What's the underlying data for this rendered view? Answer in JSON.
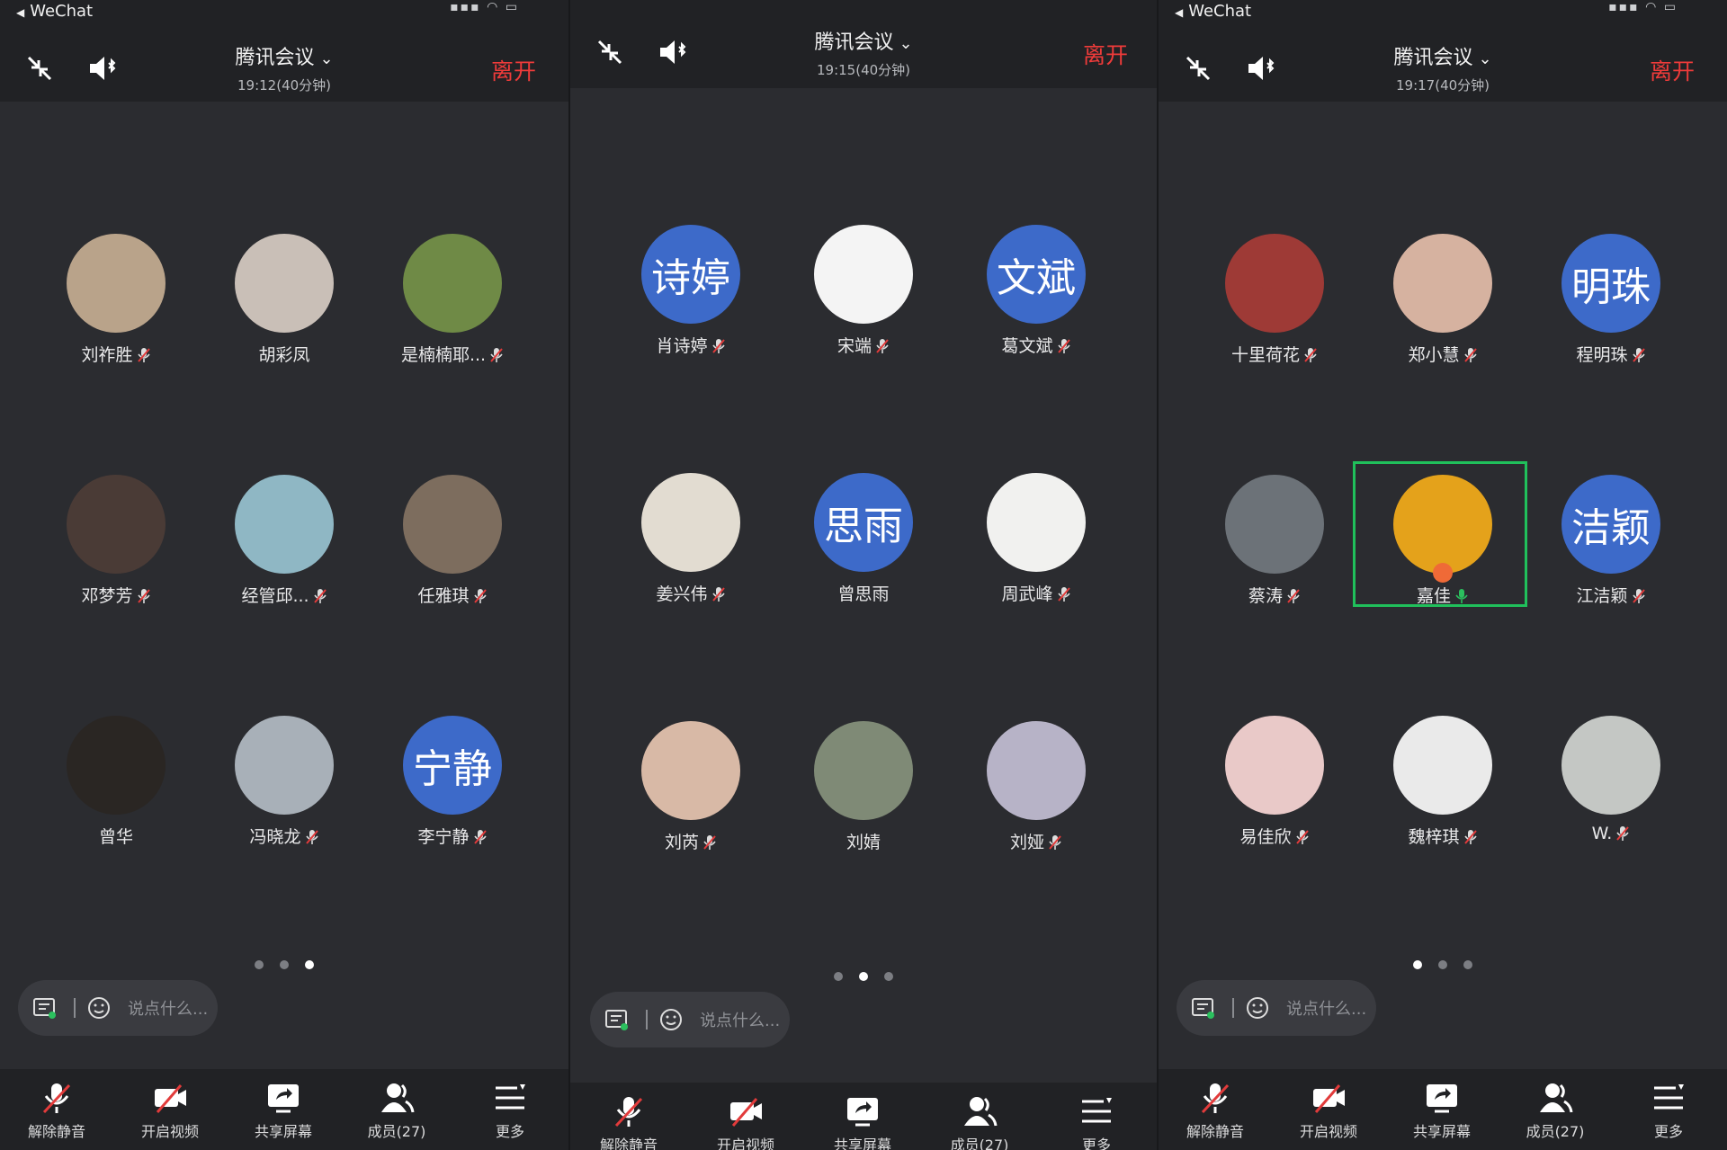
{
  "common": {
    "status_app": "WeChat",
    "meeting_title": "腾讯会议",
    "leave_label": "离开",
    "chat_placeholder": "说点什么...",
    "toolbar": [
      "解除静音",
      "开启视频",
      "共享屏幕",
      "成员(27)",
      "更多"
    ]
  },
  "panels": [
    {
      "time": "19:12(40分钟)",
      "active_page": 3,
      "participants": [
        {
          "name": "刘祚胜",
          "avatar_text": "",
          "photo_color": "#b9a38a",
          "muted": true
        },
        {
          "name": "胡彩凤",
          "avatar_text": "",
          "photo_color": "#c9bfb7",
          "muted": false
        },
        {
          "name": "是楠楠耶...",
          "avatar_text": "",
          "photo_color": "#6f8a46",
          "muted": true
        },
        {
          "name": "邓梦芳",
          "avatar_text": "",
          "photo_color": "#4a3b36",
          "muted": true
        },
        {
          "name": "经管邱...",
          "avatar_text": "",
          "photo_color": "#8fb7c4",
          "muted": true
        },
        {
          "name": "任雅琪",
          "avatar_text": "",
          "photo_color": "#7d6d5e",
          "muted": true
        },
        {
          "name": "曾华",
          "avatar_text": "",
          "photo_color": "#2a2623",
          "muted": false
        },
        {
          "name": "冯晓龙",
          "avatar_text": "",
          "photo_color": "#a8b0b8",
          "muted": true
        },
        {
          "name": "李宁静",
          "avatar_text": "宁静",
          "photo_color": "",
          "muted": true
        }
      ]
    },
    {
      "time": "19:15(40分钟)",
      "active_page": 2,
      "participants": [
        {
          "name": "肖诗婷",
          "avatar_text": "诗婷",
          "photo_color": "",
          "muted": true
        },
        {
          "name": "宋端",
          "avatar_text": "",
          "photo_color": "#f4f4f4",
          "muted": true
        },
        {
          "name": "葛文斌",
          "avatar_text": "文斌",
          "photo_color": "",
          "muted": true
        },
        {
          "name": "姜兴伟",
          "avatar_text": "",
          "photo_color": "#e2dcd1",
          "muted": true
        },
        {
          "name": "曾思雨",
          "avatar_text": "思雨",
          "photo_color": "",
          "muted": false
        },
        {
          "name": "周武峰",
          "avatar_text": "",
          "photo_color": "#f1f1ef",
          "muted": true
        },
        {
          "name": "刘芮",
          "avatar_text": "",
          "photo_color": "#d8b9a6",
          "muted": true
        },
        {
          "name": "刘婧",
          "avatar_text": "",
          "photo_color": "#7f8a76",
          "muted": false
        },
        {
          "name": "刘娅",
          "avatar_text": "",
          "photo_color": "#b7b3c7",
          "muted": true
        }
      ]
    },
    {
      "time": "19:17(40分钟)",
      "active_page": 1,
      "participants": [
        {
          "name": "十里荷花",
          "avatar_text": "",
          "photo_color": "#9e3a36",
          "muted": true
        },
        {
          "name": "郑小慧",
          "avatar_text": "",
          "photo_color": "#d6b2a0",
          "muted": true
        },
        {
          "name": "程明珠",
          "avatar_text": "明珠",
          "photo_color": "",
          "muted": true
        },
        {
          "name": "蔡涛",
          "avatar_text": "",
          "photo_color": "#6c7278",
          "muted": true
        },
        {
          "name": "嘉佳",
          "avatar_text": "",
          "photo_color": "#e4a21b",
          "muted": false,
          "speaking": true,
          "highlight": true
        },
        {
          "name": "江洁颖",
          "avatar_text": "洁颖",
          "photo_color": "",
          "muted": true
        },
        {
          "name": "易佳欣",
          "avatar_text": "",
          "photo_color": "#e9c9c8",
          "muted": true
        },
        {
          "name": "魏梓琪",
          "avatar_text": "",
          "photo_color": "#eaeaea",
          "muted": true
        },
        {
          "name": "W.",
          "avatar_text": "",
          "photo_color": "#c4c7c4",
          "muted": true
        }
      ]
    }
  ]
}
